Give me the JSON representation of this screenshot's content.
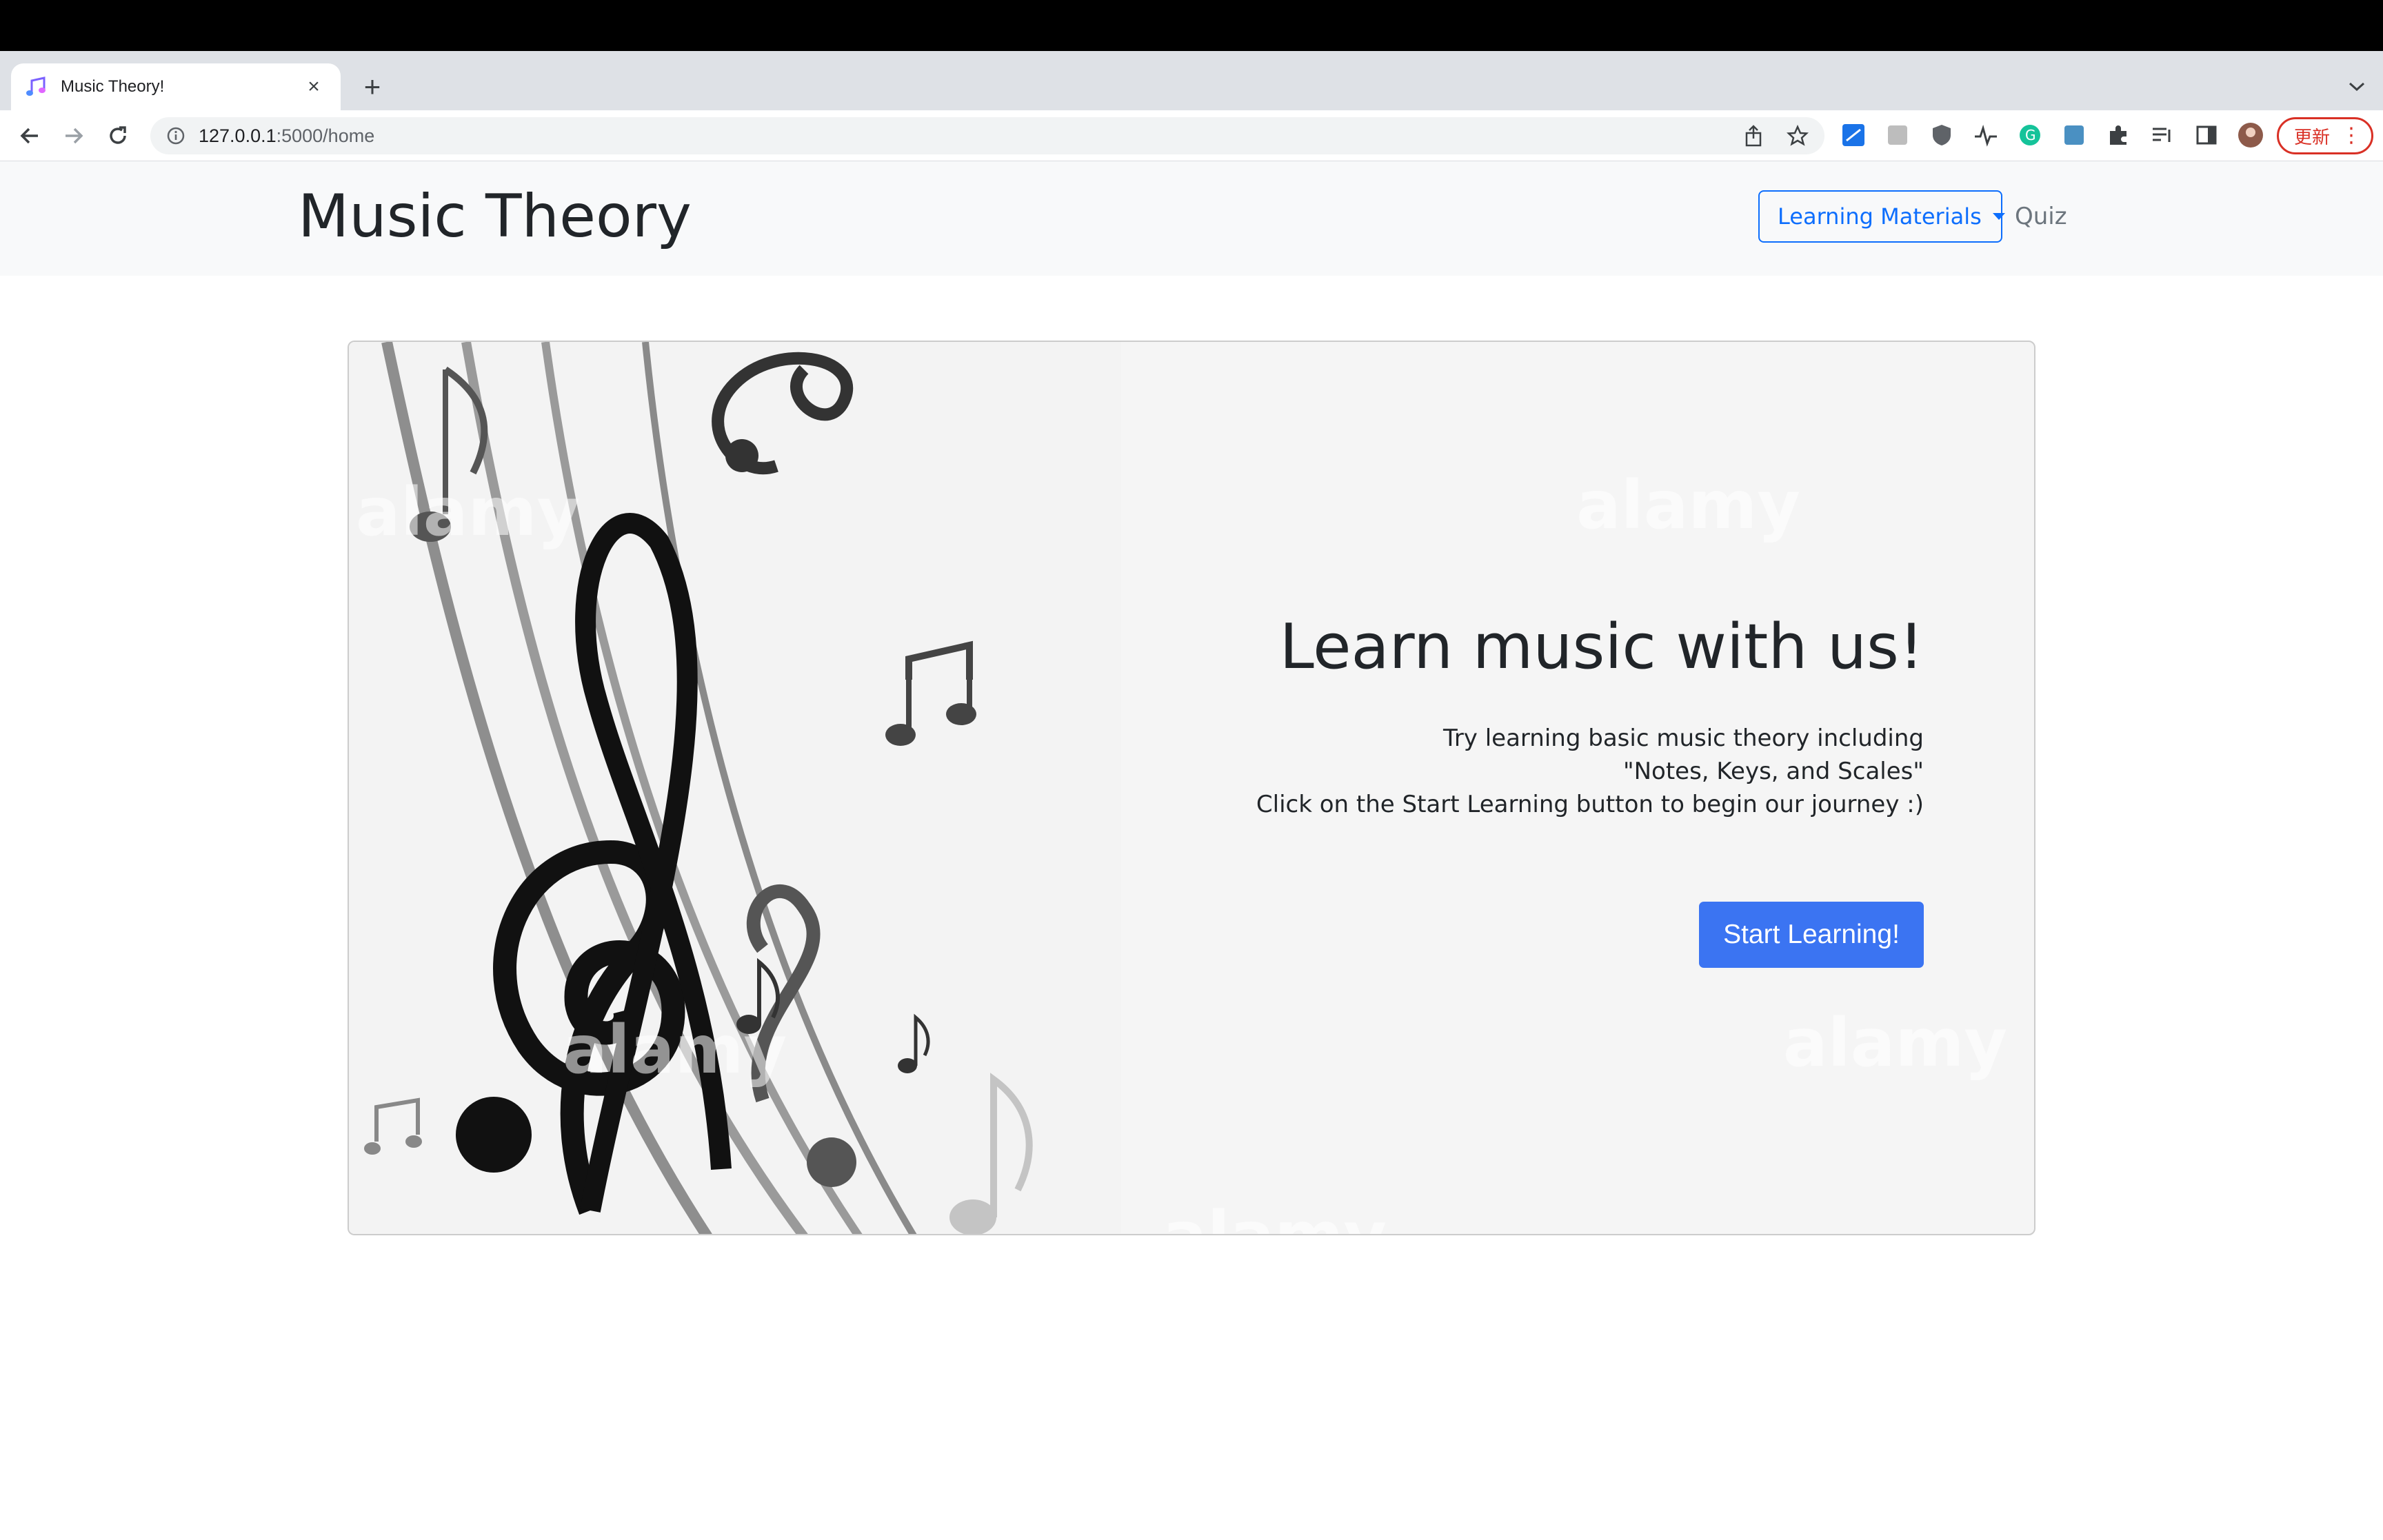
{
  "browser": {
    "tab": {
      "title": "Music Theory!"
    },
    "address": {
      "host": "127.0.0.1",
      "path": ":5000/home"
    },
    "update_label": "更新"
  },
  "page": {
    "brand": "Music Theory",
    "nav": {
      "dropdown_label": "Learning Materials",
      "quiz_label": "Quiz"
    },
    "hero": {
      "title": "Learn music with us!",
      "lines": [
        "Try learning basic music theory including",
        "\"Notes, Keys, and Scales\"",
        "Click on the Start Learning button to begin our journey :)"
      ],
      "button_label": "Start Learning!",
      "watermark_text": "alamy"
    }
  },
  "colors": {
    "primary": "#0d6efd",
    "button": "#3b74f2",
    "update": "#d93025"
  },
  "icons": [
    "music-favicon",
    "close-icon",
    "plus-icon",
    "tab-search-icon",
    "back-icon",
    "forward-icon",
    "reload-icon",
    "info-icon",
    "share-icon",
    "star-icon",
    "puzzle-icon",
    "sidebar-icon",
    "kebab-icon"
  ]
}
